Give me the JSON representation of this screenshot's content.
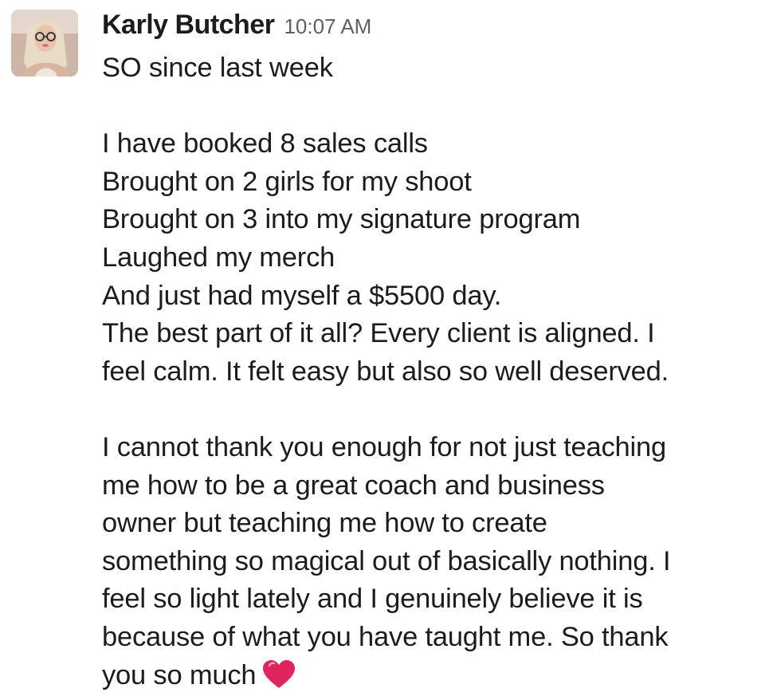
{
  "message": {
    "sender": "Karly Butcher",
    "timestamp": "10:07 AM",
    "avatar_icon": "user-avatar-photo",
    "paragraphs": [
      [
        "SO since last week"
      ],
      [
        "I have booked 8 sales calls",
        "Brought on 2 girls for my shoot",
        "Brought on 3 into my signature program",
        "Laughed my merch",
        "And just had myself a $5500 day.",
        "The best part of it all? Every client is aligned. I",
        "feel calm.  It felt easy but also so well deserved."
      ],
      [
        "I cannot thank you enough for not just teaching",
        "me how to be a great coach and business",
        "owner but teaching me how to create",
        "something so magical out of basically nothing. I",
        "feel so light lately and I genuinely believe it is",
        "because of what you have taught me. So thank",
        "you so much"
      ]
    ],
    "emoji": "heart-emoji",
    "colors": {
      "text": "#1d1c1d",
      "timestamp": "#616061",
      "heart": "#e0245e"
    }
  }
}
